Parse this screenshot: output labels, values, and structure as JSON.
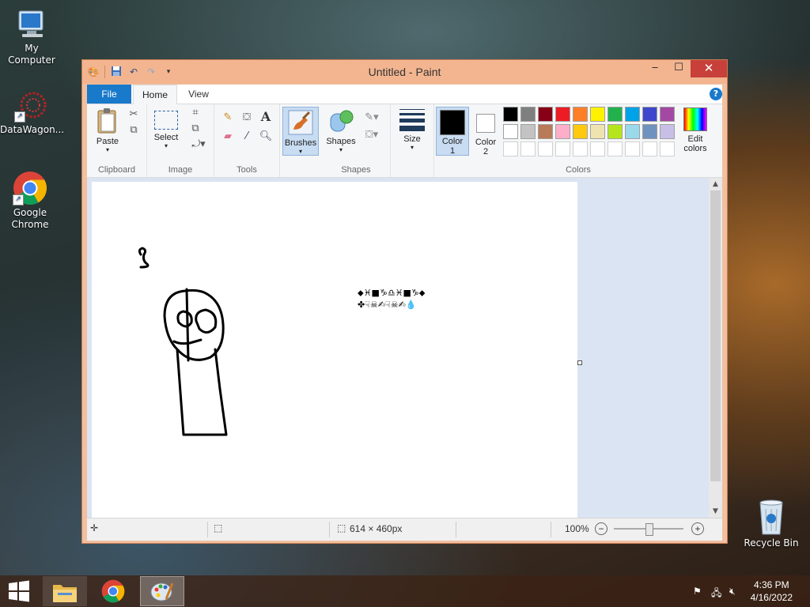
{
  "desktop": {
    "icons": [
      {
        "label": "My Computer"
      },
      {
        "label": "DataWagon..."
      },
      {
        "label": "Google Chrome"
      },
      {
        "label": "Recycle Bin"
      }
    ]
  },
  "window": {
    "title": "Untitled - Paint",
    "tabs": {
      "file": "File",
      "home": "Home",
      "view": "View"
    },
    "help": "?"
  },
  "ribbon": {
    "clipboard": {
      "label": "Clipboard",
      "paste": "Paste"
    },
    "image": {
      "label": "Image",
      "select": "Select"
    },
    "tools": {
      "label": "Tools"
    },
    "brushes": {
      "label": "Brushes"
    },
    "shapes": {
      "label": "Shapes",
      "button": "Shapes"
    },
    "size": {
      "label": "Size"
    },
    "colors": {
      "label": "Colors",
      "color1_line1": "Color",
      "color1_line2": "1",
      "color2_line1": "Color",
      "color2_line2": "2",
      "edit_line1": "Edit",
      "edit_line2": "colors",
      "color1": "#000000",
      "color2": "#ffffff",
      "palette_row1": [
        "#000000",
        "#7f7f7f",
        "#880015",
        "#ed1c24",
        "#ff7f27",
        "#fff200",
        "#22b14c",
        "#00a2e8",
        "#3f48cc",
        "#a349a4"
      ],
      "palette_row2": [
        "#ffffff",
        "#c3c3c3",
        "#b97a57",
        "#ffaec9",
        "#ffc90e",
        "#efe4b0",
        "#b5e61d",
        "#99d9ea",
        "#7092be",
        "#c8bfe7"
      ],
      "palette_row3": [
        "#ffffff",
        "#ffffff",
        "#ffffff",
        "#ffffff",
        "#ffffff",
        "#ffffff",
        "#ffffff",
        "#ffffff",
        "#ffffff",
        "#ffffff"
      ]
    }
  },
  "canvas": {
    "wingding_line1": "⬥♓■♑♎♓■♑⬥",
    "wingding_line2": "✤☟☠✍☟☠✍💧"
  },
  "status": {
    "dimensions": "614 × 460px",
    "zoom": "100%",
    "zoom_level": 0.5
  },
  "taskbar": {
    "time": "4:36 PM",
    "date": "4/16/2022"
  }
}
